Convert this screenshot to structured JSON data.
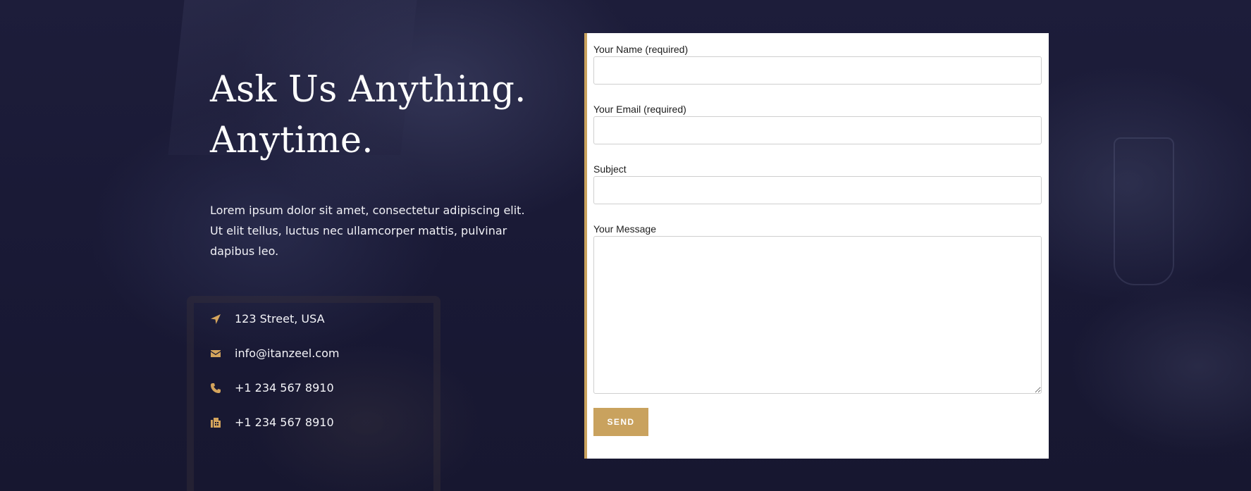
{
  "hero": {
    "headline_line1": "Ask Us Anything.",
    "headline_line2": "Anytime.",
    "intro": "Lorem ipsum dolor sit amet, consectetur adipiscing elit. Ut elit tellus, luctus nec ullamcorper mattis, pulvinar dapibus leo."
  },
  "contacts": [
    {
      "icon": "location-arrow-icon",
      "text": "123 Street, USA"
    },
    {
      "icon": "envelope-icon",
      "text": "info@itanzeel.com"
    },
    {
      "icon": "phone-icon",
      "text": "+1 234 567 8910"
    },
    {
      "icon": "fax-icon",
      "text": "+1 234 567 8910"
    }
  ],
  "form": {
    "name_label": "Your Name (required)",
    "name_value": "",
    "email_label": "Your Email (required)",
    "email_value": "",
    "subject_label": "Subject",
    "subject_value": "",
    "message_label": "Your Message",
    "message_value": "",
    "send_label": "SEND"
  },
  "colors": {
    "accent": "#c9a25e",
    "background": "#1a1a33",
    "text_light": "#ffffff"
  }
}
